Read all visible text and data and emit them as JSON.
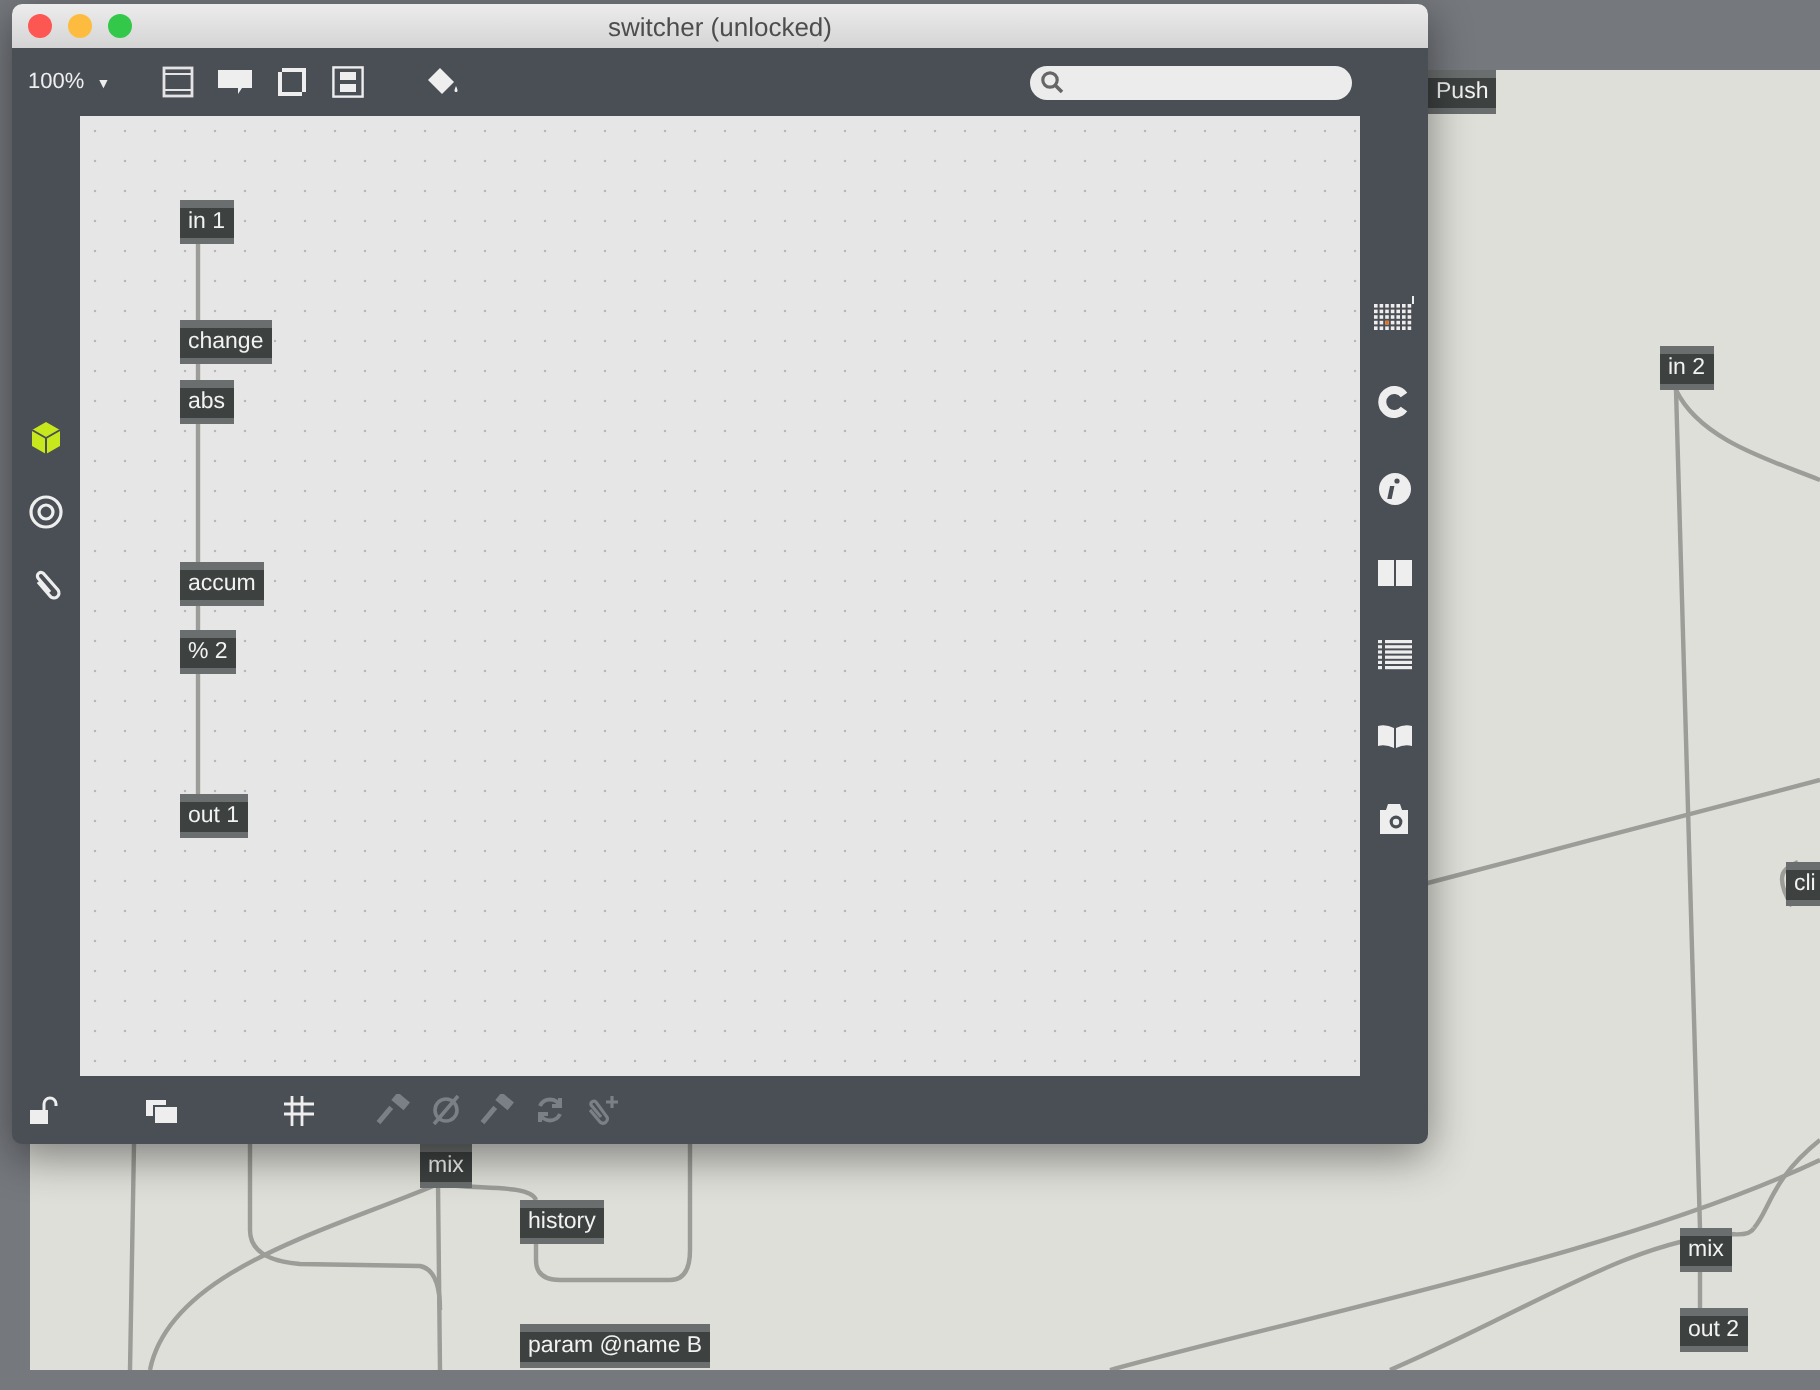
{
  "window": {
    "title": "switcher (unlocked)"
  },
  "toolbar": {
    "zoom": "100%",
    "zoom_caret": "▼"
  },
  "patch": {
    "objects": [
      {
        "text": "in 1"
      },
      {
        "text": "change"
      },
      {
        "text": "abs"
      },
      {
        "text": "accum"
      },
      {
        "text": "% 2"
      },
      {
        "text": "out 1"
      }
    ]
  },
  "bottom_tools": [
    {
      "kind": "lock",
      "disabled": false
    },
    {
      "kind": "windows",
      "disabled": false
    },
    {
      "kind": "grid",
      "disabled": false
    },
    {
      "kind": "hammer",
      "disabled": true
    },
    {
      "kind": "null",
      "disabled": true
    },
    {
      "kind": "hammer",
      "disabled": true
    },
    {
      "kind": "refresh",
      "disabled": true
    },
    {
      "kind": "clip",
      "disabled": true
    }
  ],
  "background_patch": {
    "objects": [
      {
        "text": "Push"
      },
      {
        "text": "in 2"
      },
      {
        "text": "cli"
      },
      {
        "text": "mix"
      },
      {
        "text": "history"
      },
      {
        "text": "mix"
      },
      {
        "text": "out 2"
      },
      {
        "text": "param @name B"
      }
    ]
  }
}
